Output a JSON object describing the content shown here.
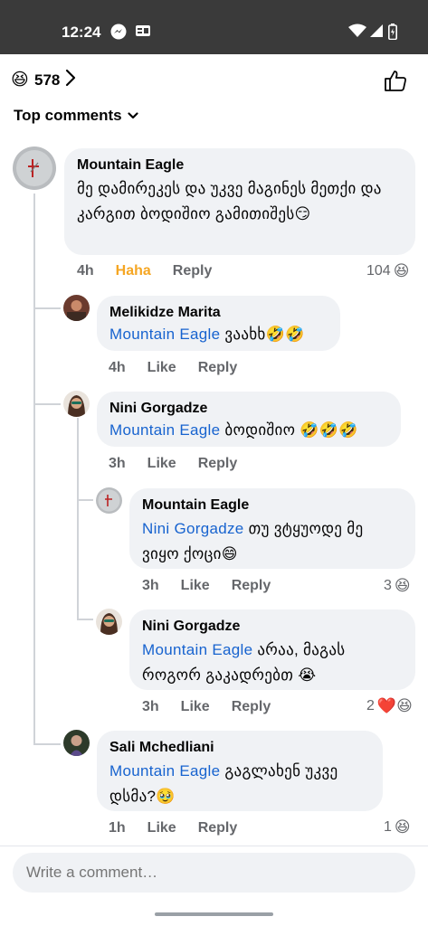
{
  "status_bar": {
    "time": "12:24"
  },
  "header": {
    "reaction_emoji": "😆",
    "reaction_count": "578",
    "sort_label": "Top comments"
  },
  "comments": [
    {
      "author": "Mountain Eagle",
      "mention": "",
      "text": "მე დამირეკეს და უკვე მაგინეს მეთქი და კარგით ბოდიშიო გამითიშეს😏",
      "time": "4h",
      "reaction_label": "Haha",
      "reply_label": "Reply",
      "reaction_count": "104",
      "reaction_emojis": "😆"
    },
    {
      "author": "Melikidze Marita",
      "mention": "Mountain Eagle",
      "text": " ვაახხ🤣🤣",
      "time": "4h",
      "like_label": "Like",
      "reply_label": "Reply"
    },
    {
      "author": "Nini Gorgadze",
      "mention": "Mountain Eagle",
      "text": " ბოდიშიო 🤣🤣🤣",
      "time": "3h",
      "like_label": "Like",
      "reply_label": "Reply"
    },
    {
      "author": "Mountain Eagle",
      "mention": "Nini Gorgadze",
      "text": " თუ ვტყუოდე მე ვიყო ქოცი😄",
      "time": "3h",
      "like_label": "Like",
      "reply_label": "Reply",
      "reaction_count": "3",
      "reaction_emojis": "😆"
    },
    {
      "author": "Nini Gorgadze",
      "mention": "Mountain Eagle",
      "text": " არაა, მაგას როგორ გაკადრებთ 😭",
      "time": "3h",
      "like_label": "Like",
      "reply_label": "Reply",
      "reaction_count": "2",
      "reaction_emojis": "❤️😆"
    },
    {
      "author": "Sali Mchedliani",
      "mention": "Mountain Eagle",
      "text": " გაგლახენ უკვე დსმა?🥹",
      "time": "1h",
      "like_label": "Like",
      "reply_label": "Reply",
      "reaction_count": "1",
      "reaction_emojis": "😆"
    }
  ],
  "composer": {
    "placeholder": "Write a comment…"
  }
}
